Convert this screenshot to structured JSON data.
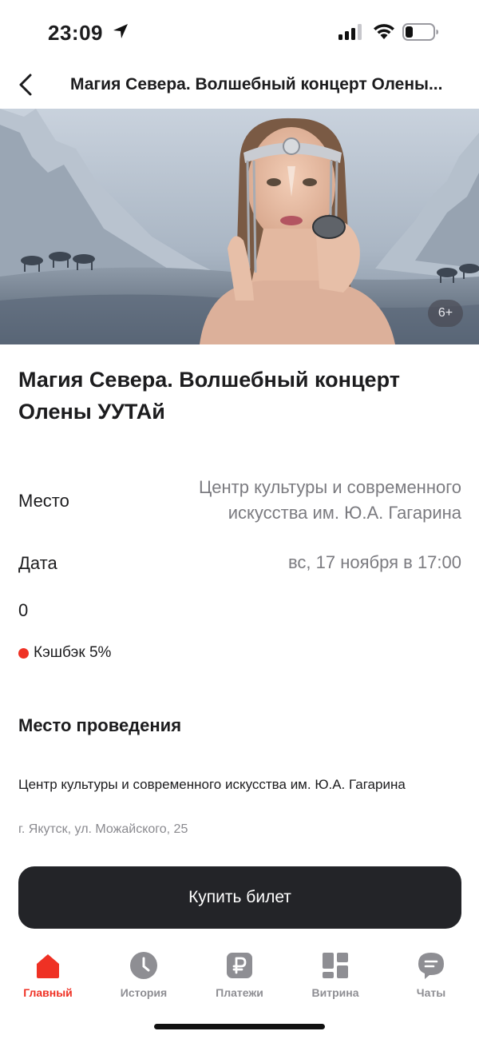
{
  "status_bar": {
    "time": "23:09",
    "icons": [
      "location-arrow-icon",
      "cellular-signal-icon",
      "wifi-icon",
      "battery-icon"
    ]
  },
  "nav": {
    "title": "Магия Севера. Волшебный концерт Олены...",
    "back_icon": "chevron-left-icon"
  },
  "hero": {
    "age_rating": "6+"
  },
  "event": {
    "title": "Магия Севера. Волшебный концерт Олены УУТАй",
    "place_label": "Место",
    "place_value_line1": "Центр культуры и современного",
    "place_value_line2": "искусства им. Ю.А. Гагарина",
    "date_label": "Дата",
    "date_value": "вс, 17 ноября в 17:00",
    "price": "0",
    "cashback": "Кэшбэк 5%"
  },
  "venue": {
    "section_title": "Место проведения",
    "name": "Центр культуры и современного искусства им. Ю.А. Гагарина",
    "address": "г. Якутск, ул. Можайского, 25"
  },
  "actions": {
    "buy_label": "Купить билет"
  },
  "tabs": [
    {
      "label": "Главный",
      "icon": "home-icon",
      "active": true
    },
    {
      "label": "История",
      "icon": "clock-icon",
      "active": false
    },
    {
      "label": "Платежи",
      "icon": "ruble-icon",
      "active": false
    },
    {
      "label": "Витрина",
      "icon": "grid-icon",
      "active": false
    },
    {
      "label": "Чаты",
      "icon": "chat-bubble-icon",
      "active": false
    }
  ],
  "colors": {
    "accent": "#ef3124",
    "button_bg": "#232428",
    "secondary_text": "#7b7b80",
    "tab_inactive": "#8e8e93"
  }
}
